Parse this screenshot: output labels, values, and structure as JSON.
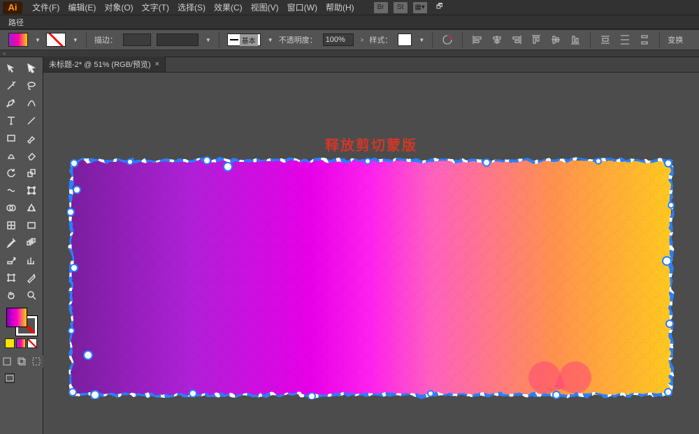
{
  "app": {
    "logo": "Ai"
  },
  "menu": {
    "file": "文件(F)",
    "edit": "编辑(E)",
    "object": "对象(O)",
    "type": "文字(T)",
    "select": "选择(S)",
    "effect": "效果(C)",
    "view": "视图(V)",
    "window": "窗口(W)",
    "help": "帮助(H)",
    "br": "Br",
    "st": "St"
  },
  "modebar": {
    "label": "路径"
  },
  "options": {
    "stroke_label": "描边：",
    "stroke_weight": "",
    "basic_label": "基本",
    "opacity_label": "不透明度：",
    "opacity_value": "100%",
    "style_label": "样式：",
    "transform_label": "变换"
  },
  "tab": {
    "title": "未标题-2* @ 51% (RGB/预览)",
    "close": "×"
  },
  "annotation": {
    "text": "释放剪切蒙版"
  },
  "colors": {
    "gradient_stops": [
      "#7a1fa0",
      "#ff00cc",
      "#ffd000"
    ],
    "selection_blue": "#2a7fff",
    "annotation_red": "#d03828"
  }
}
